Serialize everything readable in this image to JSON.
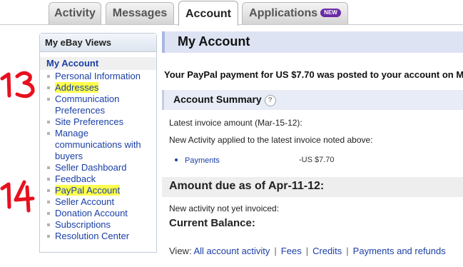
{
  "tabs": [
    {
      "label": "Activity",
      "active": false
    },
    {
      "label": "Messages",
      "active": false
    },
    {
      "label": "Account",
      "active": true
    },
    {
      "label": "Applications",
      "active": false,
      "badge": "NEW"
    }
  ],
  "sidebar": {
    "title": "My eBay Views",
    "top_item": "My Account",
    "items": [
      {
        "label": "Personal Information"
      },
      {
        "label": "Addresses",
        "highlighted": true
      },
      {
        "label": "Communication Preferences"
      },
      {
        "label": "Site Preferences"
      },
      {
        "label": "Manage communications with buyers"
      },
      {
        "label": "Seller Dashboard"
      },
      {
        "label": "Feedback"
      },
      {
        "label": "PayPal Account",
        "highlighted": true
      },
      {
        "label": "Seller Account"
      },
      {
        "label": "Donation Account"
      },
      {
        "label": "Subscriptions"
      },
      {
        "label": "Resolution Center"
      }
    ]
  },
  "annotations": {
    "first": "13",
    "second": "14",
    "color": "#e8101e"
  },
  "main": {
    "title": "My Account",
    "notice": "Your PayPal payment for US $7.70 was posted to your account on M",
    "summary_title": "Account Summary",
    "help_glyph": "?",
    "latest_invoice": "Latest invoice amount  (Mar-15-12):",
    "new_activity": "New Activity applied to the latest invoice noted above:",
    "payments_label": "Payments",
    "payments_amount": "-US $7.70",
    "amount_due": "Amount due as of Apr-11-12:",
    "not_invoiced": "New activity not yet invoiced:",
    "current_balance": "Current Balance:",
    "view_label": "View:",
    "view_links": [
      "All account activity",
      "Fees",
      "Credits",
      "Payments and refunds"
    ]
  },
  "colors": {
    "link": "#1a3fa6",
    "highlight": "#ffff4d",
    "badge": "#6b2aa5",
    "title_bar": "#dee3f4"
  }
}
